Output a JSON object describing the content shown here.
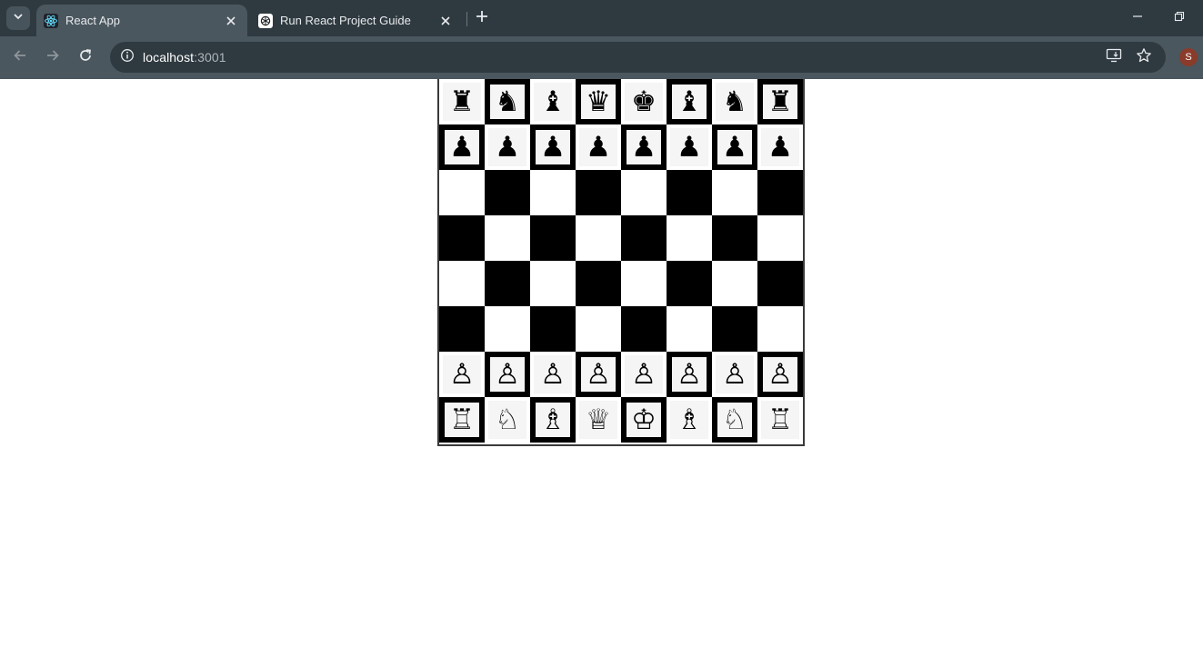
{
  "browser": {
    "tabs": [
      {
        "title": "React App",
        "favicon": "react-logo-icon",
        "active": true
      },
      {
        "title": "Run React Project Guide",
        "favicon": "openai-logo-icon",
        "active": false
      }
    ],
    "url_host": "localhost",
    "url_port": ":3001",
    "profile_initial": "S"
  },
  "board": {
    "rows": [
      [
        "♜",
        "♞",
        "♝",
        "♛",
        "♚",
        "♝",
        "♞",
        "♜"
      ],
      [
        "♟",
        "♟",
        "♟",
        "♟",
        "♟",
        "♟",
        "♟",
        "♟"
      ],
      [
        "",
        "",
        "",
        "",
        "",
        "",
        "",
        ""
      ],
      [
        "",
        "",
        "",
        "",
        "",
        "",
        "",
        ""
      ],
      [
        "",
        "",
        "",
        "",
        "",
        "",
        "",
        ""
      ],
      [
        "",
        "",
        "",
        "",
        "",
        "",
        "",
        ""
      ],
      [
        "♙",
        "♙",
        "♙",
        "♙",
        "♙",
        "♙",
        "♙",
        "♙"
      ],
      [
        "♖",
        "♘",
        "♗",
        "♕",
        "♔",
        "♗",
        "♘",
        "♖"
      ]
    ],
    "piece_names": {
      "♜": "black-rook",
      "♞": "black-knight",
      "♝": "black-bishop",
      "♛": "black-queen",
      "♚": "black-king",
      "♟": "black-pawn",
      "♖": "white-rook",
      "♘": "white-knight",
      "♗": "white-bishop",
      "♕": "white-queen",
      "♔": "white-king",
      "♙": "white-pawn"
    },
    "colors": {
      "light": "#ffffff",
      "dark": "#000000"
    }
  }
}
